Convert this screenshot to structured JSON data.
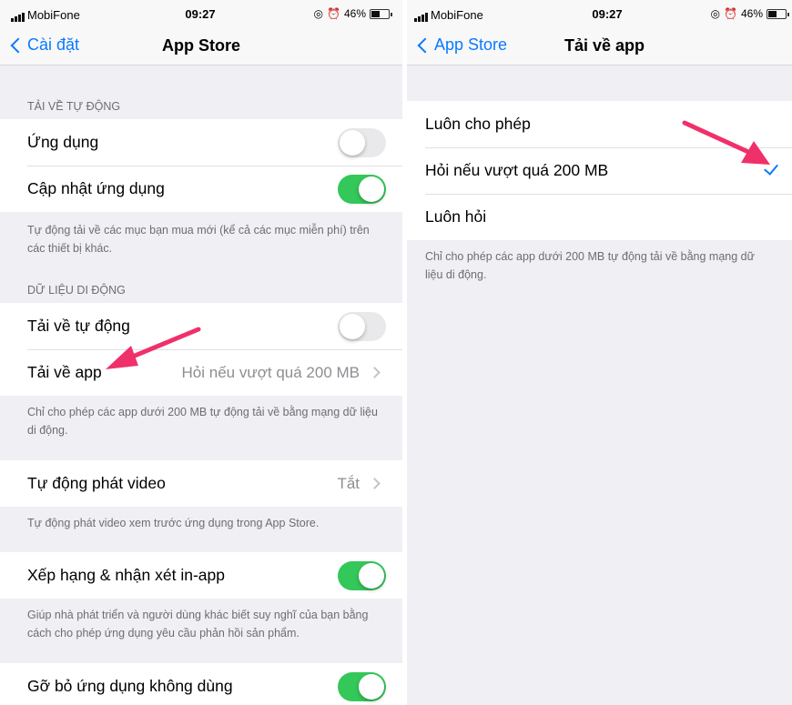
{
  "status": {
    "carrier": "MobiFone",
    "time": "09:27",
    "battery": "46%"
  },
  "left": {
    "nav": {
      "back_label": "Cài đặt",
      "title": "App Store"
    },
    "auto_downloads": {
      "header": "TẢI VỀ TỰ ĐỘNG",
      "apps_label": "Ứng dụng",
      "apps_on": false,
      "updates_label": "Cập nhật ứng dụng",
      "updates_on": true,
      "footer": "Tự động tải về các mục bạn mua mới (kể cả các mục miễn phí) trên các thiết bị khác."
    },
    "cellular": {
      "header": "DỮ LIỆU DI ĐỘNG",
      "auto_download_label": "Tải về tự động",
      "auto_download_on": false,
      "app_downloads_label": "Tải về app",
      "app_downloads_value": "Hỏi nếu vượt quá 200 MB",
      "footer": "Chỉ cho phép các app dưới 200 MB tự động tải về bằng mạng dữ liệu di động."
    },
    "video": {
      "label": "Tự động phát video",
      "value": "Tắt",
      "footer": "Tự động phát video xem trước ứng dụng trong App Store."
    },
    "ratings": {
      "label": "Xếp hạng & nhận xét in-app",
      "on": true,
      "footer": "Giúp nhà phát triển và người dùng khác biết suy nghĩ của bạn bằng cách cho phép ứng dụng yêu cầu phản hồi sản phẩm."
    },
    "offload": {
      "label": "Gỡ bỏ ứng dụng không dùng",
      "on": true
    }
  },
  "right": {
    "nav": {
      "back_label": "App Store",
      "title": "Tải về app"
    },
    "options": [
      {
        "label": "Luôn cho phép",
        "selected": false
      },
      {
        "label": "Hỏi nếu vượt quá 200 MB",
        "selected": true
      },
      {
        "label": "Luôn hỏi",
        "selected": false
      }
    ],
    "footer": "Chỉ cho phép các app dưới 200 MB tự động tải về bằng mạng dữ liệu di động."
  },
  "colors": {
    "accent": "#0a7aff",
    "toggle_on": "#34c759",
    "annotation_arrow": "#f0306a"
  }
}
